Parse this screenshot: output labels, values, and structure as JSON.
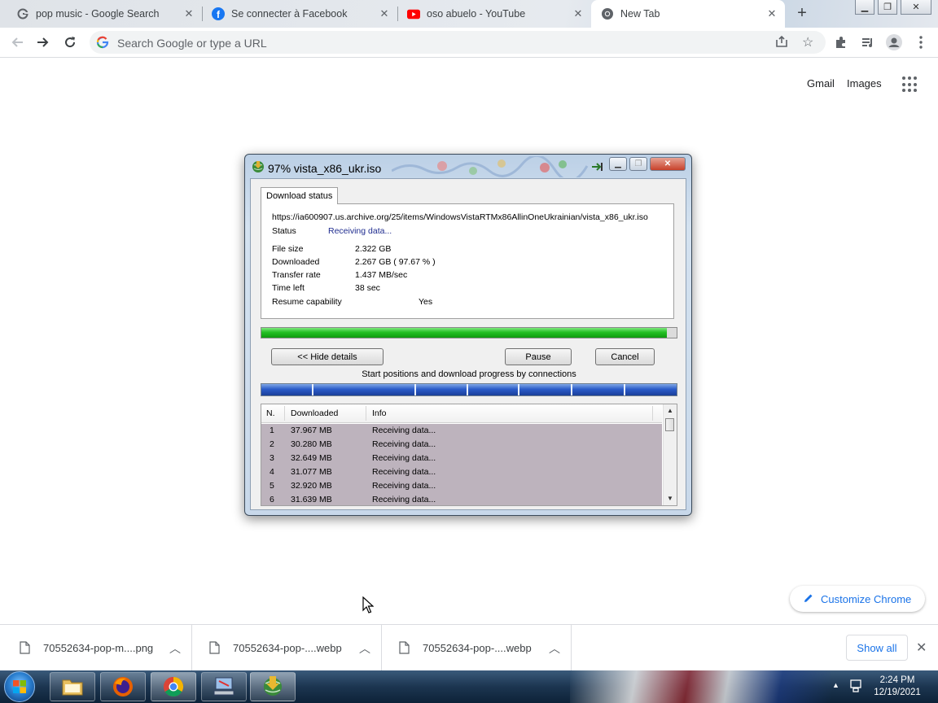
{
  "browser": {
    "tabs": [
      {
        "title": "pop music - Google Search",
        "icon": "google-g-icon"
      },
      {
        "title": "Se connecter à Facebook",
        "icon": "facebook-icon"
      },
      {
        "title": "oso abuelo - YouTube",
        "icon": "youtube-icon"
      },
      {
        "title": "New Tab",
        "icon": "chrome-icon"
      }
    ],
    "omnibox_placeholder": "Search Google or type a URL"
  },
  "ntp": {
    "gmail": "Gmail",
    "images": "Images",
    "customize": "Customize Chrome"
  },
  "idm": {
    "title": "97% vista_x86_ukr.iso",
    "tab_label": "Download status",
    "url": "https://ia600907.us.archive.org/25/items/WindowsVistaRTMx86AllinOneUkrainian/vista_x86_ukr.iso",
    "status_label": "Status",
    "status_value": "Receiving data...",
    "file_size_label": "File size",
    "file_size_value": "2.322  GB",
    "downloaded_label": "Downloaded",
    "downloaded_value": "2.267  GB  ( 97.67 % )",
    "transfer_rate_label": "Transfer rate",
    "transfer_rate_value": "1.437  MB/sec",
    "time_left_label": "Time left",
    "time_left_value": "38 sec",
    "resume_label": "Resume capability",
    "resume_value": "Yes",
    "progress_percent": 97.67,
    "hide_details_label": "<< Hide details",
    "pause_label": "Pause",
    "cancel_label": "Cancel",
    "connections_label": "Start positions and download progress by connections",
    "columns": [
      "N.",
      "Downloaded",
      "Info"
    ],
    "connections": [
      {
        "n": "1",
        "downloaded": "37.967  MB",
        "info": "Receiving data..."
      },
      {
        "n": "2",
        "downloaded": "30.280  MB",
        "info": "Receiving data..."
      },
      {
        "n": "3",
        "downloaded": "32.649  MB",
        "info": "Receiving data..."
      },
      {
        "n": "4",
        "downloaded": "31.077  MB",
        "info": "Receiving data..."
      },
      {
        "n": "5",
        "downloaded": "32.920  MB",
        "info": "Receiving data..."
      },
      {
        "n": "6",
        "downloaded": "31.639  MB",
        "info": "Receiving data..."
      }
    ]
  },
  "downloads": {
    "items": [
      {
        "name": "70552634-pop-m....png"
      },
      {
        "name": "70552634-pop-....webp"
      },
      {
        "name": "70552634-pop-....webp"
      }
    ],
    "show_all": "Show all"
  },
  "taskbar": {
    "time": "2:24 PM",
    "date": "12/19/2021"
  },
  "colors": {
    "accent": "#1a73e8",
    "progress_green": "#25c025",
    "connection_blue": "#2b5cc9",
    "row_highlight": "#bdb3bd"
  }
}
